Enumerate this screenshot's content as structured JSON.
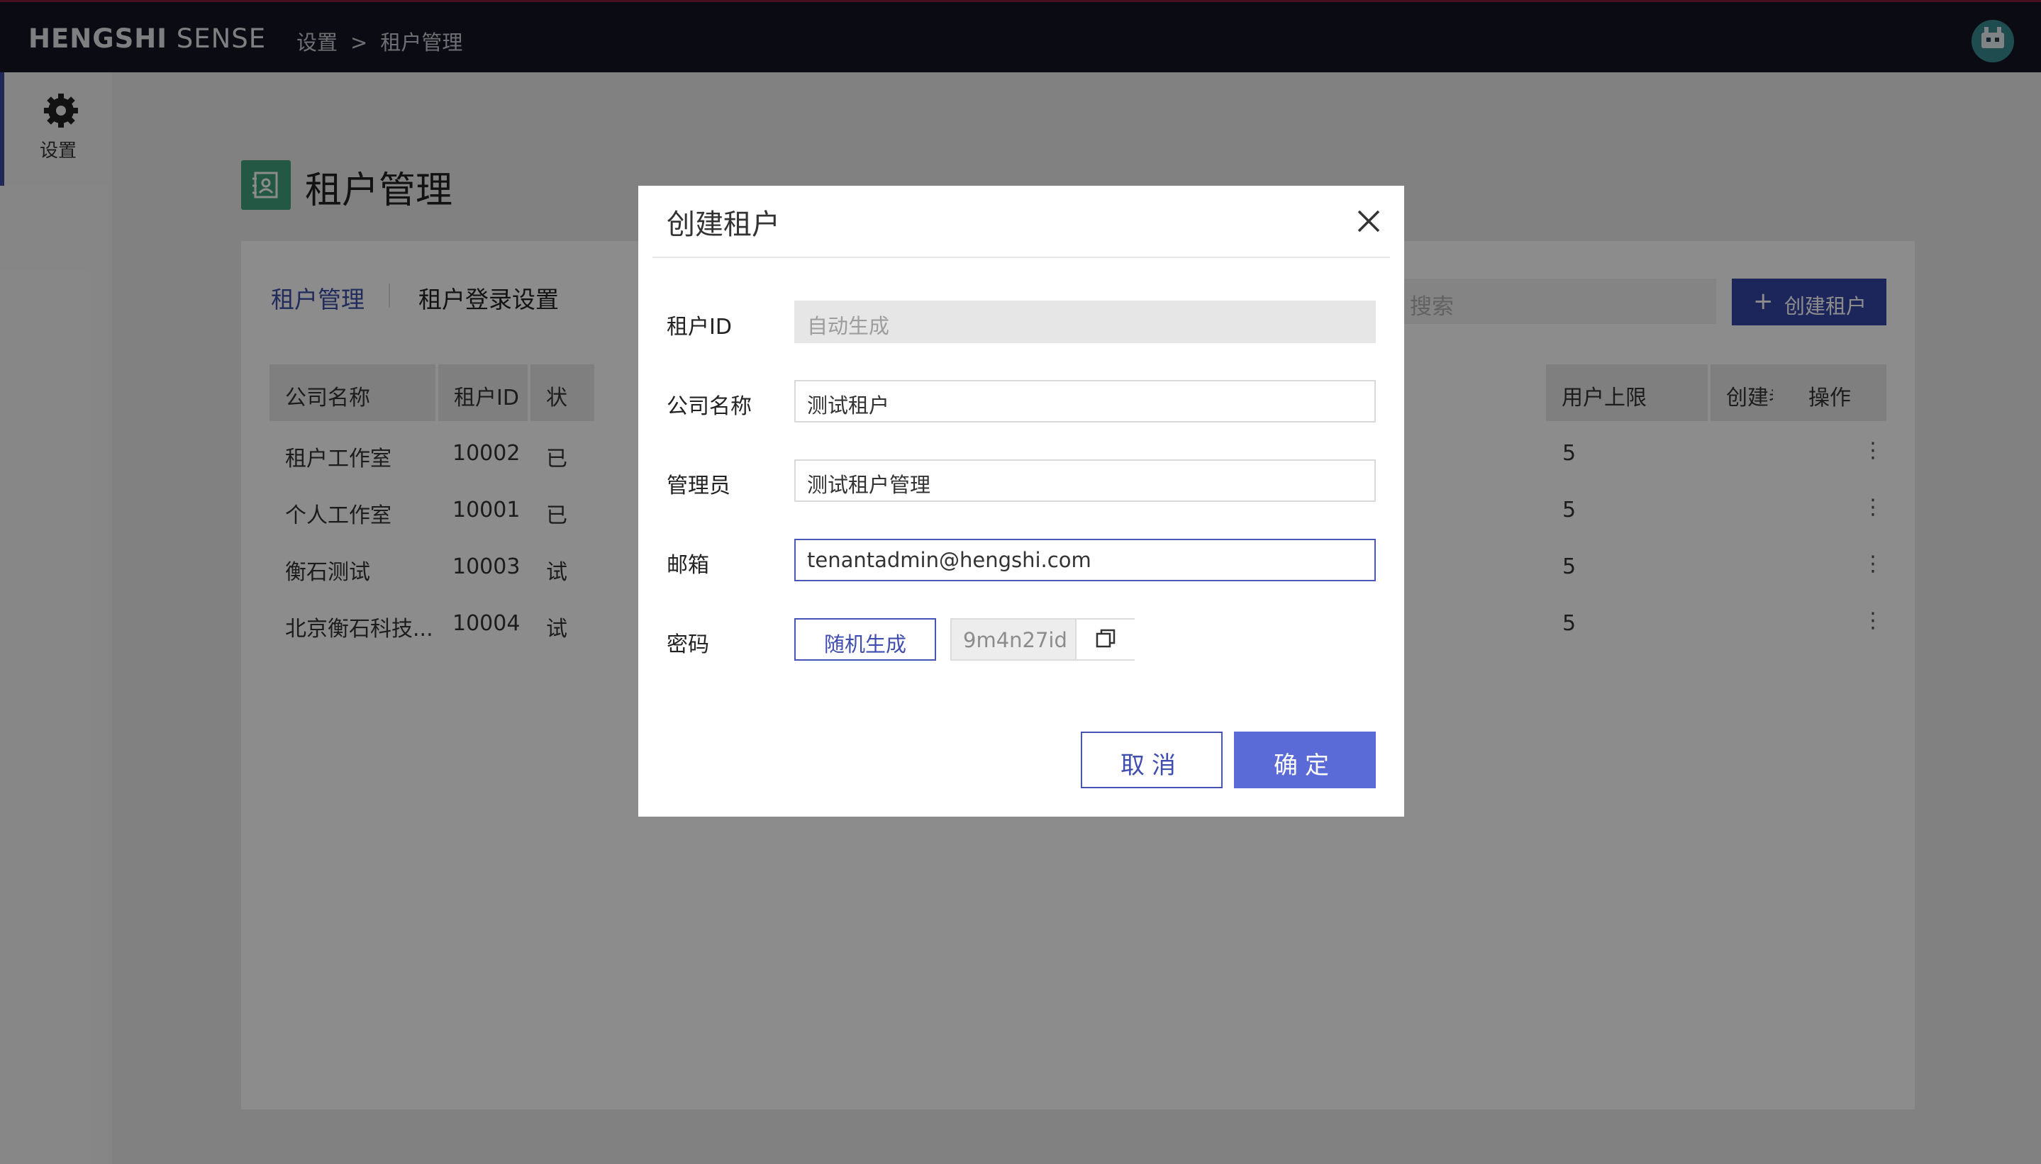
{
  "header": {
    "brand_bold": "HENGSHI",
    "brand_light": "SENSE",
    "breadcrumb": [
      "设置",
      ">",
      "租户管理"
    ]
  },
  "sidebar": {
    "items": [
      {
        "label": "设置",
        "icon": "gear-icon"
      }
    ]
  },
  "page": {
    "title": "租户管理"
  },
  "tabs": [
    {
      "label": "租户管理",
      "active": true
    },
    {
      "label": "租户登录设置",
      "active": false
    }
  ],
  "search": {
    "placeholder": "搜索"
  },
  "create_button": {
    "icon": "+",
    "label": "创建租户"
  },
  "table": {
    "columns": [
      "公司名称",
      "租户ID",
      "状",
      "用户上限",
      "创建者",
      "操作"
    ],
    "rows": [
      {
        "company": "租户工作室",
        "id": "10002",
        "status": "已",
        "limit": "5",
        "actions": "⋮"
      },
      {
        "company": "个人工作室",
        "id": "10001",
        "status": "已",
        "limit": "5",
        "actions": "⋮"
      },
      {
        "company": "衡石测试",
        "id": "10003",
        "status": "试",
        "limit": "5",
        "actions": "⋮"
      },
      {
        "company": "北京衡石科技...",
        "id": "10004",
        "status": "试",
        "limit": "5",
        "actions": "⋮"
      }
    ]
  },
  "modal": {
    "title": "创建租户",
    "fields": [
      {
        "label": "租户ID",
        "value": "",
        "placeholder": "自动生成",
        "disabled": true
      },
      {
        "label": "公司名称",
        "value": "测试租户"
      },
      {
        "label": "管理员",
        "value": "测试租户管理"
      },
      {
        "label": "邮箱",
        "value": "tenantadmin@hengshi.com",
        "focused": true
      },
      {
        "label": "密码"
      }
    ],
    "generate_button": "随机生成",
    "password_value": "9m4n27id",
    "cancel_label": "取消",
    "ok_label": "确定"
  },
  "colors": {
    "primary": "#3646a6",
    "topbar": "#141724",
    "accent_icon": "#3fa07d"
  }
}
